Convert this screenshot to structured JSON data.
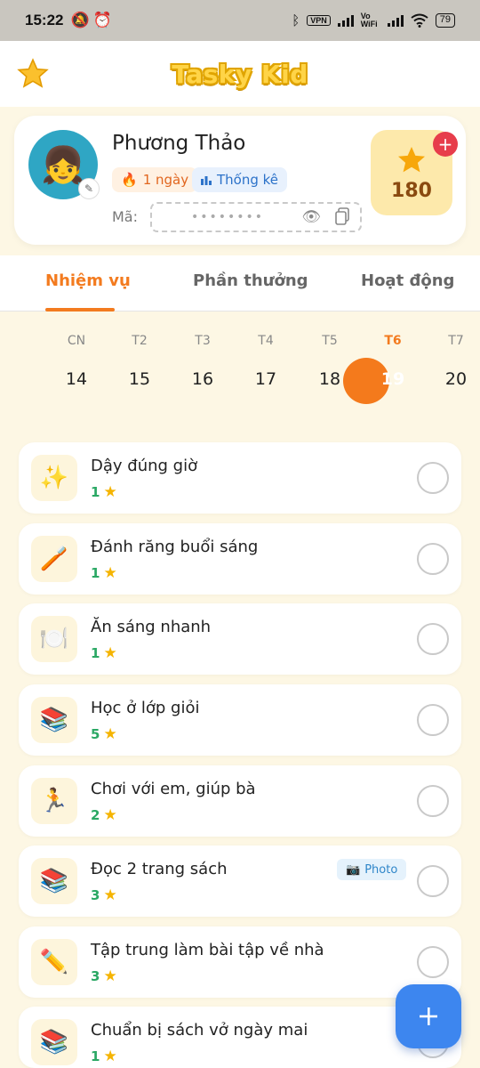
{
  "status_bar": {
    "time": "15:22",
    "left_icons": [
      "mute-icon",
      "alarm-icon"
    ],
    "vpn": "VPN",
    "wifi_label": "Vo WiFi",
    "battery": "79"
  },
  "app": {
    "title": "Tasky Kid"
  },
  "profile": {
    "name": "Phương Thảo",
    "avatar": "👧",
    "streak_label": "1 ngày",
    "stats_label": "Thống kê",
    "code_label": "Mã:",
    "code_masked": "••••••••",
    "points": "180"
  },
  "tabs": [
    {
      "label": "Nhiệm vụ",
      "active": true
    },
    {
      "label": "Phần thưởng",
      "active": false
    },
    {
      "label": "Hoạt động",
      "active": false
    }
  ],
  "week": [
    {
      "name": "CN",
      "date": "14"
    },
    {
      "name": "T2",
      "date": "15"
    },
    {
      "name": "T3",
      "date": "16"
    },
    {
      "name": "T4",
      "date": "17"
    },
    {
      "name": "T5",
      "date": "18"
    },
    {
      "name": "T6",
      "date": "19",
      "selected": true
    },
    {
      "name": "T7",
      "date": "20"
    }
  ],
  "tasks": [
    {
      "icon": "✨",
      "icon_name": "sparkles-icon",
      "name": "Dậy đúng giờ",
      "points": "1"
    },
    {
      "icon": "🪥",
      "icon_name": "toothbrush-icon",
      "name": "Đánh răng buổi sáng",
      "points": "1"
    },
    {
      "icon": "🍽️",
      "icon_name": "plate-icon",
      "name": "Ăn sáng nhanh",
      "points": "1"
    },
    {
      "icon": "📚",
      "icon_name": "books-icon",
      "name": "Học ở lớp giỏi",
      "points": "5"
    },
    {
      "icon": "🏃",
      "icon_name": "running-icon",
      "name": "Chơi với em, giúp bà",
      "points": "2"
    },
    {
      "icon": "📚",
      "icon_name": "books-icon",
      "name": "Đọc 2 trang sách",
      "points": "3",
      "badge": "Photo"
    },
    {
      "icon": "✏️",
      "icon_name": "pencil-icon",
      "name": "Tập trung làm bài tập về nhà",
      "points": "3"
    },
    {
      "icon": "📚",
      "icon_name": "books-icon",
      "name": "Chuẩn bị sách vở ngày mai",
      "points": "1"
    }
  ],
  "colors": {
    "accent": "#f37b1f",
    "fab": "#3d86ef",
    "background": "#fdf7e4"
  }
}
